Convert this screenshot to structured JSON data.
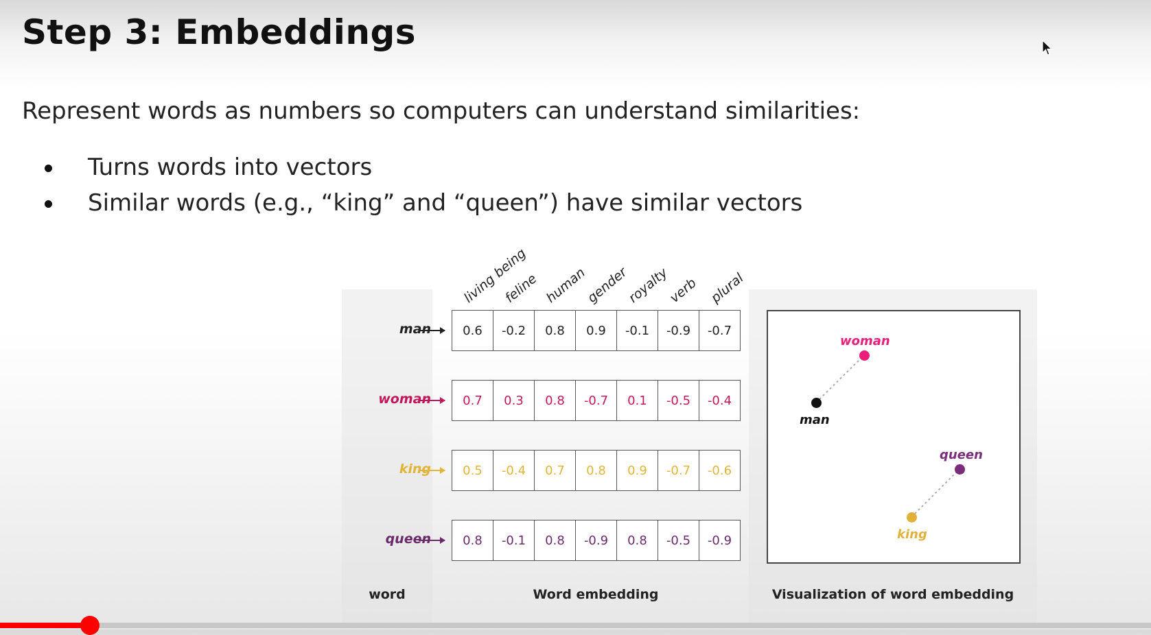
{
  "slide": {
    "title": "Step 3: Embeddings",
    "intro": "Represent words as numbers so computers can understand similarities:",
    "bullets": [
      "Turns words into vectors",
      "Similar words (e.g., “king” and “queen”) have similar vectors"
    ]
  },
  "figure": {
    "features": [
      "living being",
      "feline",
      "human",
      "gender",
      "royalty",
      "verb",
      "plural"
    ],
    "rows": [
      {
        "word": "man",
        "color": "#222222",
        "values": [
          "0.6",
          "-0.2",
          "0.8",
          "0.9",
          "-0.1",
          "-0.9",
          "-0.7"
        ]
      },
      {
        "word": "woman",
        "color": "#c2185b",
        "values": [
          "0.7",
          "0.3",
          "0.8",
          "-0.7",
          "0.1",
          "-0.5",
          "-0.4"
        ]
      },
      {
        "word": "king",
        "color": "#e0b53a",
        "values": [
          "0.5",
          "-0.4",
          "0.7",
          "0.8",
          "0.9",
          "-0.7",
          "-0.6"
        ]
      },
      {
        "word": "queen",
        "color": "#6a2a6a",
        "values": [
          "0.8",
          "-0.1",
          "0.8",
          "-0.9",
          "0.8",
          "-0.5",
          "-0.9"
        ]
      }
    ],
    "captions": {
      "word": "word",
      "embedding": "Word embedding",
      "visualization": "Visualization of word embedding"
    },
    "visualization": {
      "points": [
        {
          "label": "woman",
          "color": "#e91e7a"
        },
        {
          "label": "man",
          "color": "#111111"
        },
        {
          "label": "queen",
          "color": "#7b2d7b"
        },
        {
          "label": "king",
          "color": "#e2b13c"
        }
      ]
    }
  },
  "player": {
    "progress_fraction": 0.078,
    "accent": "#ff0000"
  }
}
